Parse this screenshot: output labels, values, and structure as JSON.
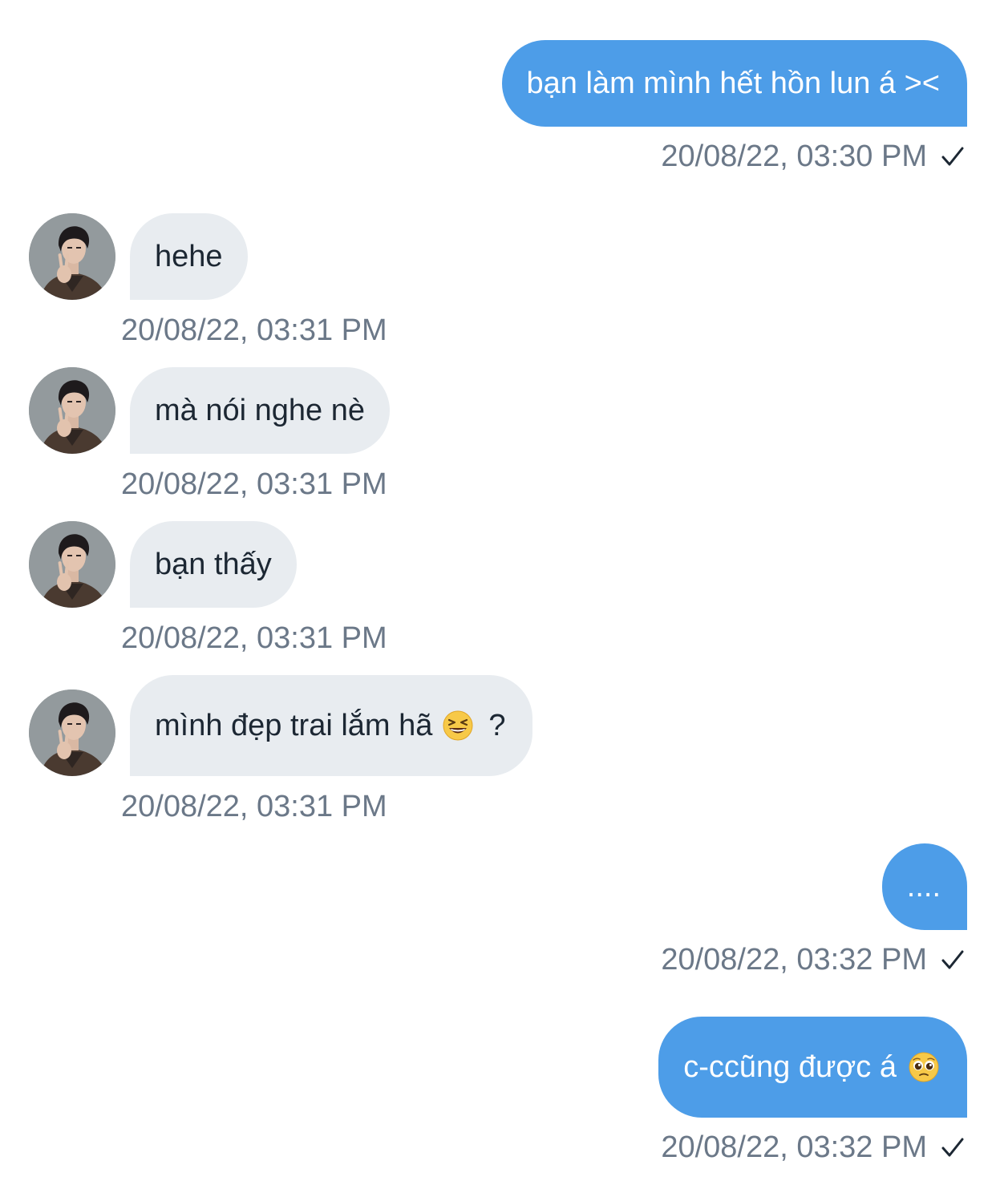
{
  "messages": [
    {
      "direction": "sent",
      "text": "bạn làm mình hết hồn lun á ><",
      "time": "20/08/22, 03:30 PM",
      "status_icon": "check-icon"
    },
    {
      "direction": "received",
      "text": "hehe",
      "time": "20/08/22, 03:31 PM"
    },
    {
      "direction": "received",
      "text": "mà nói nghe nè",
      "time": "20/08/22, 03:31 PM"
    },
    {
      "direction": "received",
      "text": "bạn thấy",
      "time": "20/08/22, 03:31 PM"
    },
    {
      "direction": "received",
      "text": "mình đẹp trai lắm hã",
      "text_suffix": "?",
      "emoji": "grinning-squinting-face-emoji",
      "time": "20/08/22, 03:31 PM"
    },
    {
      "direction": "sent",
      "text": "....",
      "time": "20/08/22, 03:32 PM",
      "status_icon": "check-icon"
    },
    {
      "direction": "sent",
      "text": "c-ccũng được á",
      "emoji": "pleading-face-emoji",
      "time": "20/08/22, 03:32 PM",
      "status_icon": "check-icon"
    }
  ],
  "colors": {
    "sent_bubble": "#4d9de8",
    "received_bubble": "#e8ecf0",
    "timestamp": "#6b7888",
    "received_text": "#1c2733"
  }
}
